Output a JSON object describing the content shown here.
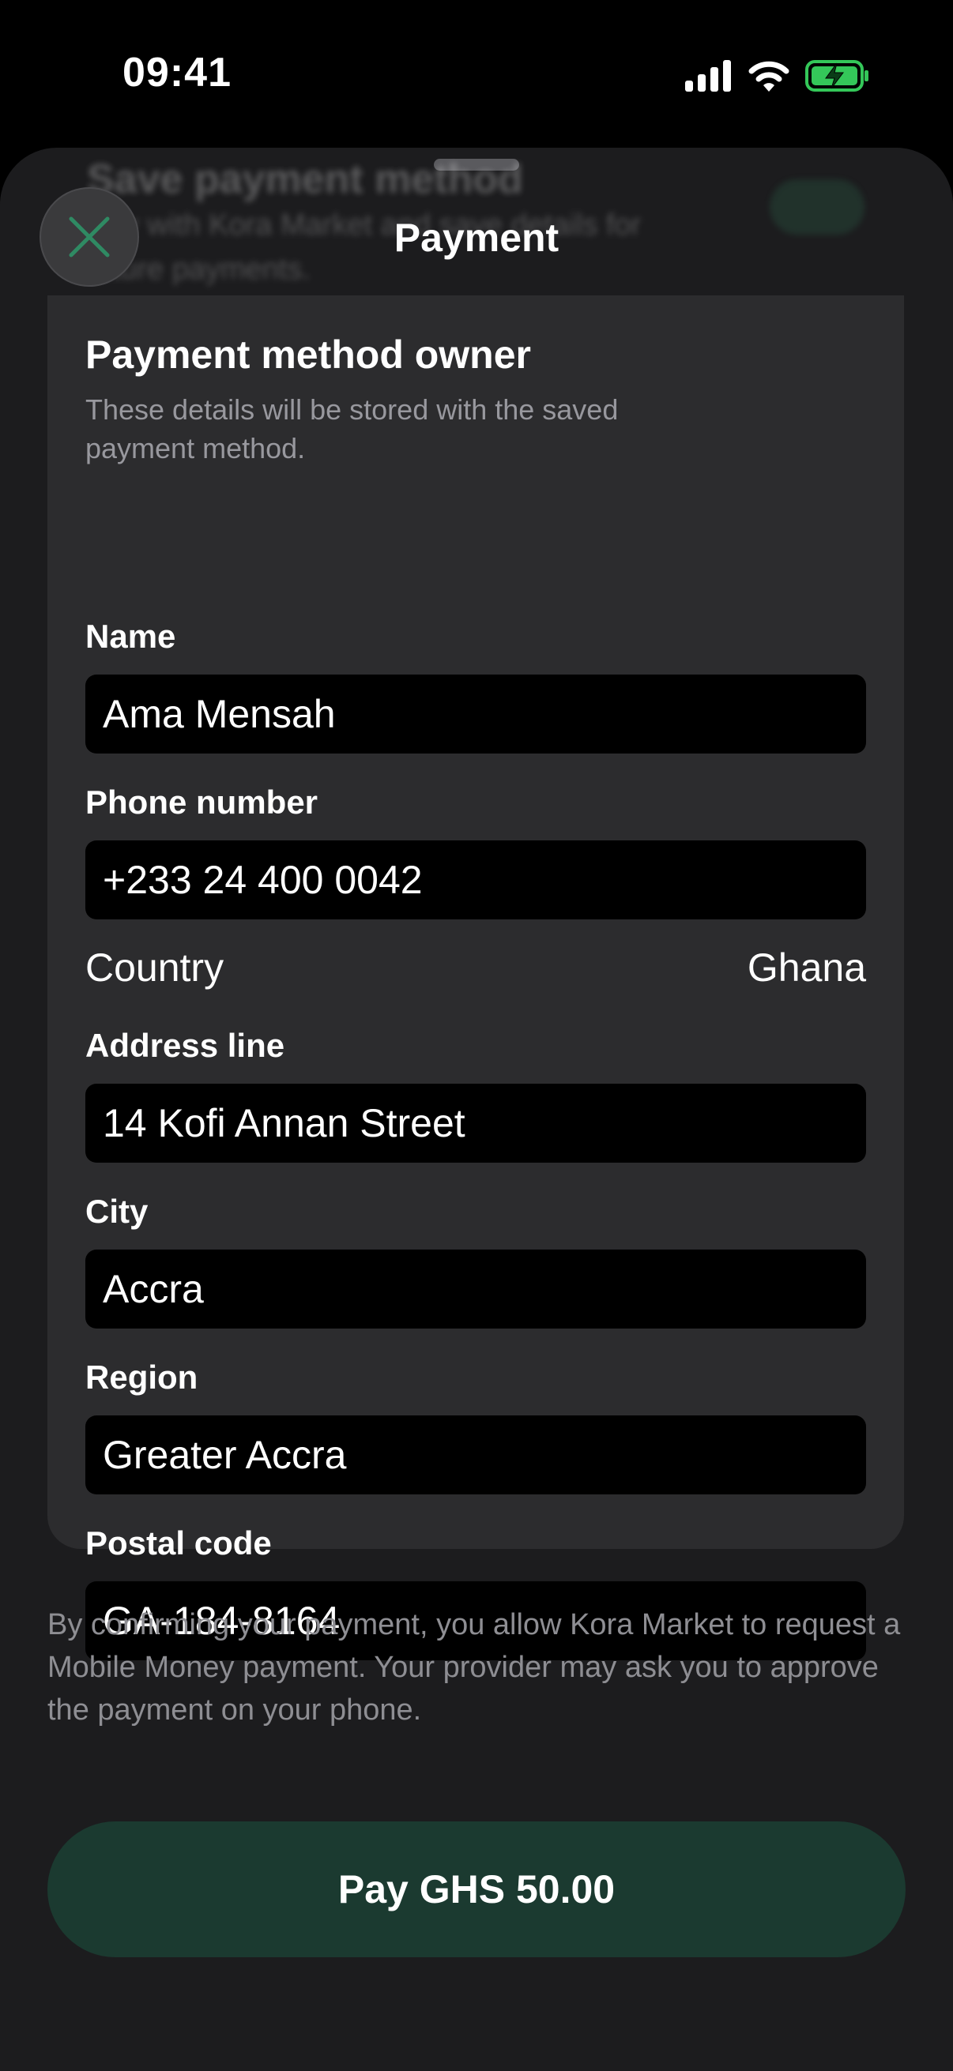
{
  "status_bar": {
    "time": "09:41"
  },
  "behind_content": {
    "title": "Save payment method",
    "text": "Pay with Kora Market and save details for future payments."
  },
  "header": {
    "title": "Payment"
  },
  "owner": {
    "title": "Payment method owner",
    "subtitle": "These details will be stored with the saved payment method."
  },
  "fields": {
    "name": {
      "label": "Name",
      "value": "Ama Mensah"
    },
    "phone": {
      "label": "Phone number",
      "value": "+233 24 400 0042"
    },
    "country": {
      "label": "Country",
      "value": "Ghana"
    },
    "address": {
      "label": "Address line",
      "value": "14 Kofi Annan Street"
    },
    "city": {
      "label": "City",
      "value": "Accra"
    },
    "region": {
      "label": "Region",
      "value": "Greater Accra"
    },
    "postal": {
      "label": "Postal code",
      "value": "GA-184-8164"
    }
  },
  "legal_text": "By confirming your payment, you allow Kora Market to request a Mobile Money payment. Your provider may ask you to approve the payment on your phone.",
  "pay_button": {
    "label": "Pay GHS 50.00"
  },
  "colors": {
    "accent_green": "#2f8a63",
    "pay_button_bg": "#1b3a30",
    "sheet_bg": "#1c1c1e",
    "card_bg": "#2c2c2e",
    "battery_green": "#34c759"
  },
  "icons": [
    "signal-icon",
    "wifi-icon",
    "battery-charging-icon",
    "close-icon"
  ]
}
